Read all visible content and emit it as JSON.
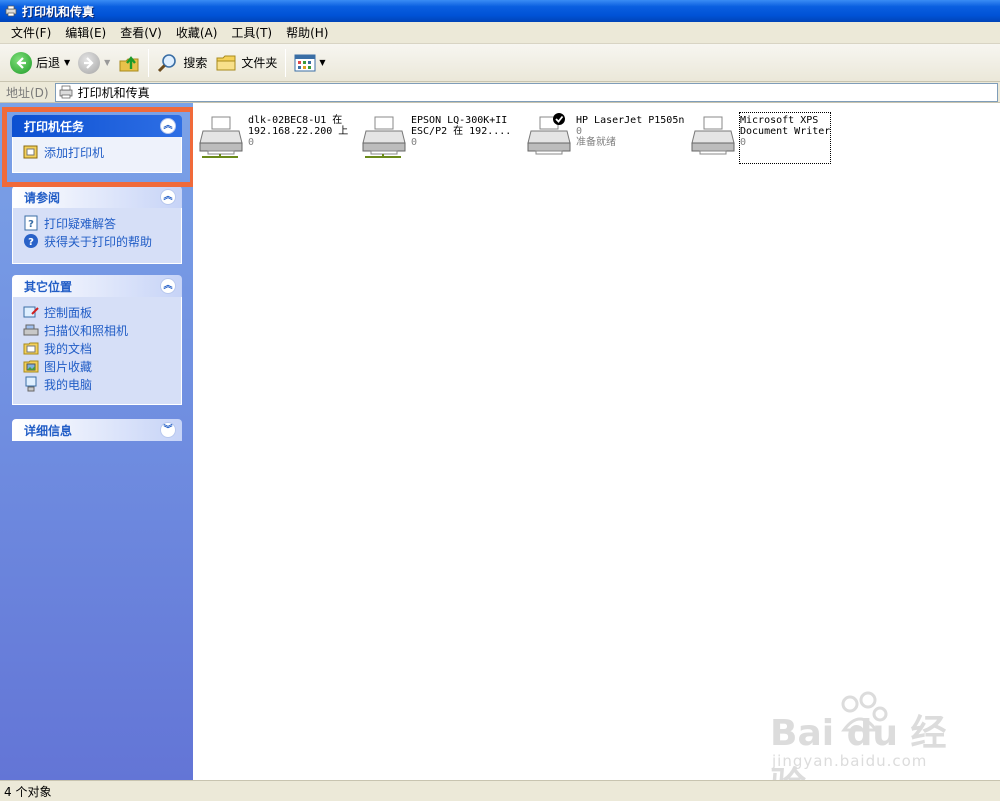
{
  "window": {
    "title": "打印机和传真"
  },
  "menu": [
    "文件(F)",
    "编辑(E)",
    "查看(V)",
    "收藏(A)",
    "工具(T)",
    "帮助(H)"
  ],
  "toolbar": {
    "back_label": "后退",
    "search_label": "搜索",
    "folders_label": "文件夹"
  },
  "address": {
    "label": "地址(D)",
    "value": "打印机和传真"
  },
  "tasks": {
    "printer_tasks": {
      "title": "打印机任务",
      "items": [
        "添加打印机"
      ]
    },
    "see_also": {
      "title": "请参阅",
      "items": [
        "打印疑难解答",
        "获得关于打印的帮助"
      ]
    },
    "other_places": {
      "title": "其它位置",
      "items": [
        "控制面板",
        "扫描仪和照相机",
        "我的文档",
        "图片收藏",
        "我的电脑"
      ]
    },
    "details": {
      "title": "详细信息"
    }
  },
  "printers": [
    {
      "line1": "dlk-02BEC8-U1 在",
      "line2": "192.168.22.200 上",
      "line3": "0",
      "network": true,
      "default": false
    },
    {
      "line1": "EPSON LQ-300K+II",
      "line2": "ESC/P2 在 192....",
      "line3": "0",
      "network": true,
      "default": false
    },
    {
      "line1": "HP LaserJet P1505n",
      "line2": "0",
      "line3": "准备就绪",
      "network": false,
      "default": true
    },
    {
      "line1": "Microsoft XPS",
      "line2": "Document Writer",
      "line3": "0",
      "network": false,
      "default": false
    }
  ],
  "status": {
    "text": "4 个对象"
  },
  "watermark": {
    "brand": "Bai du 经验",
    "url": "jingyan.baidu.com"
  }
}
